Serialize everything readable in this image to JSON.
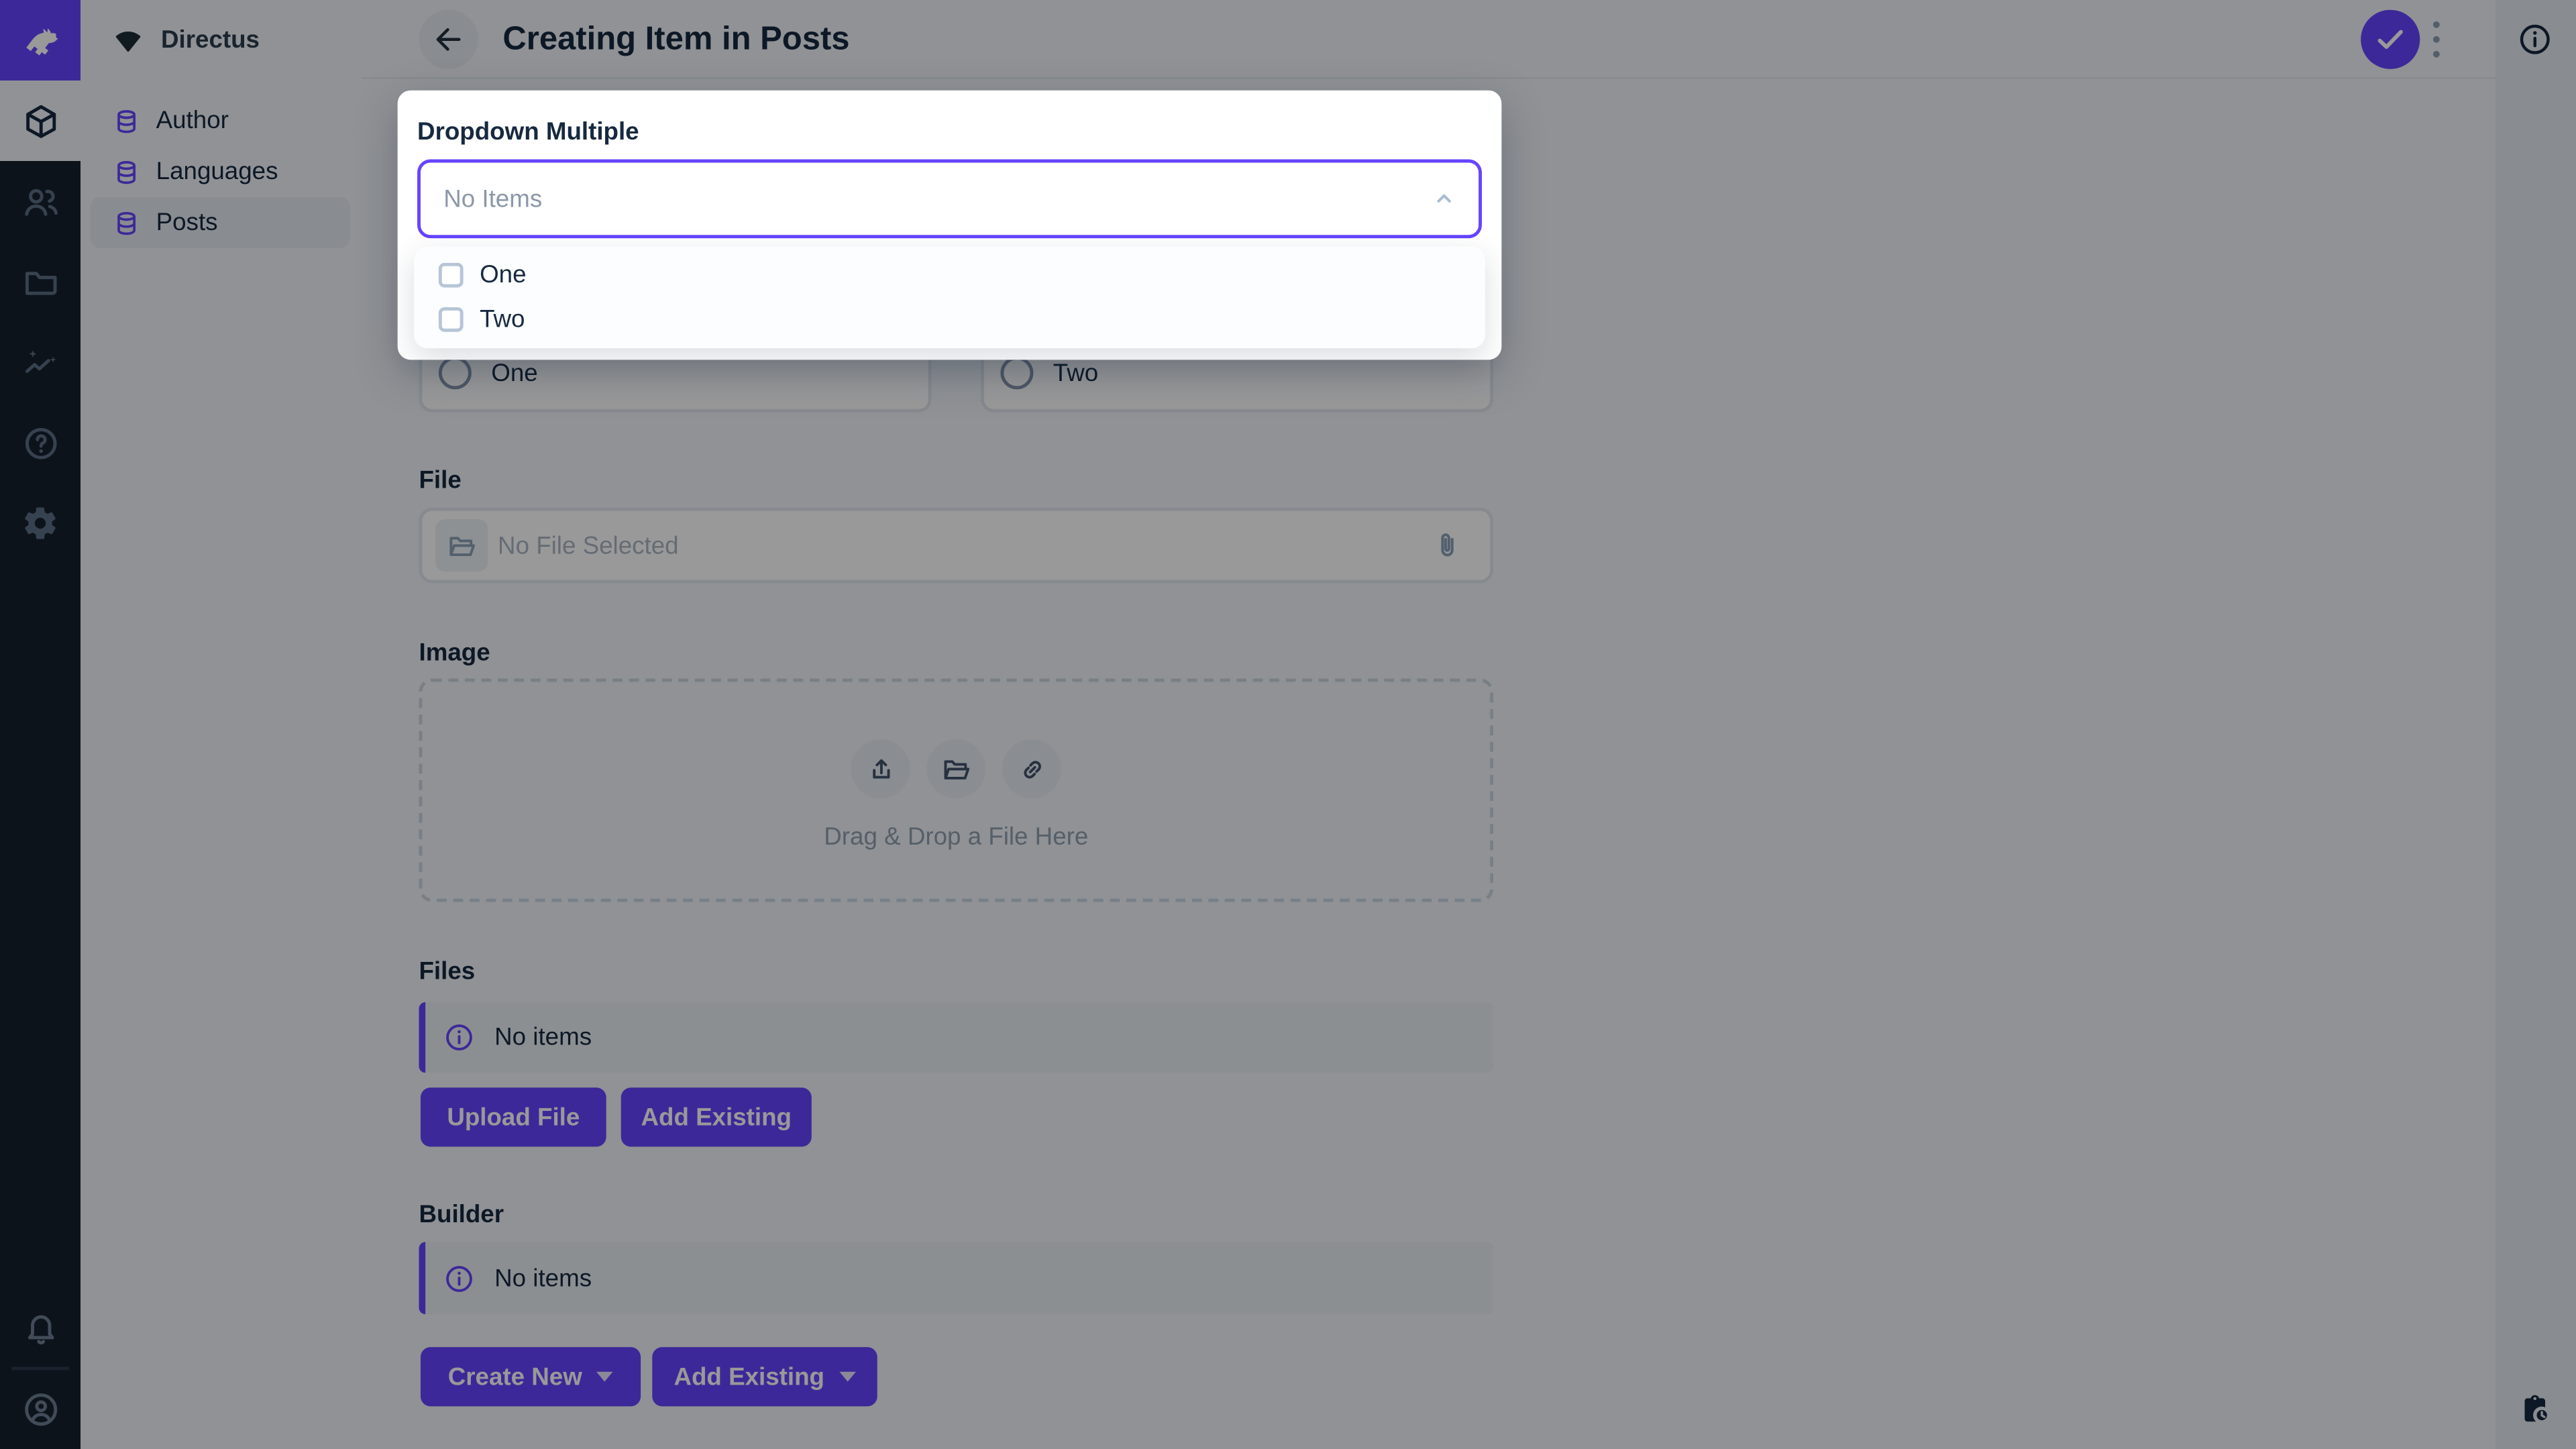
{
  "colors": {
    "accent": "#6644ff",
    "module_bar_bg": "#16202e",
    "page_bg": "#f0f4f9",
    "panel_bg": "#e4eaf1",
    "text_dark": "#172940",
    "text_muted": "#8f9eb0",
    "placeholder": "#a9b5c4",
    "border_soft": "#e0e7ef",
    "border_dash": "#c9d4e0",
    "icon_muted": "#8ba0b6",
    "module_icon": "#5c6f85",
    "menu_bg": "#fbfdfe",
    "notice_bg": "#e9eef3",
    "overlay": "rgba(0,0,0,0.4)"
  },
  "nav": {
    "project_name": "Directus",
    "items": [
      {
        "label": "Author",
        "active": false
      },
      {
        "label": "Languages",
        "active": false
      },
      {
        "label": "Posts",
        "active": true
      }
    ]
  },
  "header": {
    "title": "Creating Item in Posts"
  },
  "popover": {
    "field_label": "Dropdown Multiple",
    "select_value": "No Items",
    "options": [
      {
        "label": "One",
        "checked": false
      },
      {
        "label": "Two",
        "checked": false
      }
    ]
  },
  "form": {
    "radio_options": [
      {
        "label": "One",
        "selected": false
      },
      {
        "label": "Two",
        "selected": false
      }
    ],
    "file": {
      "label": "File",
      "placeholder": "No File Selected"
    },
    "image": {
      "label": "Image",
      "dropzone_text": "Drag & Drop a File Here"
    },
    "files": {
      "label": "Files",
      "notice": "No items",
      "buttons": [
        {
          "label": "Upload File"
        },
        {
          "label": "Add Existing"
        }
      ]
    },
    "builder": {
      "label": "Builder",
      "notice": "No items",
      "buttons": [
        {
          "label": "Create New"
        },
        {
          "label": "Add Existing"
        }
      ]
    }
  }
}
